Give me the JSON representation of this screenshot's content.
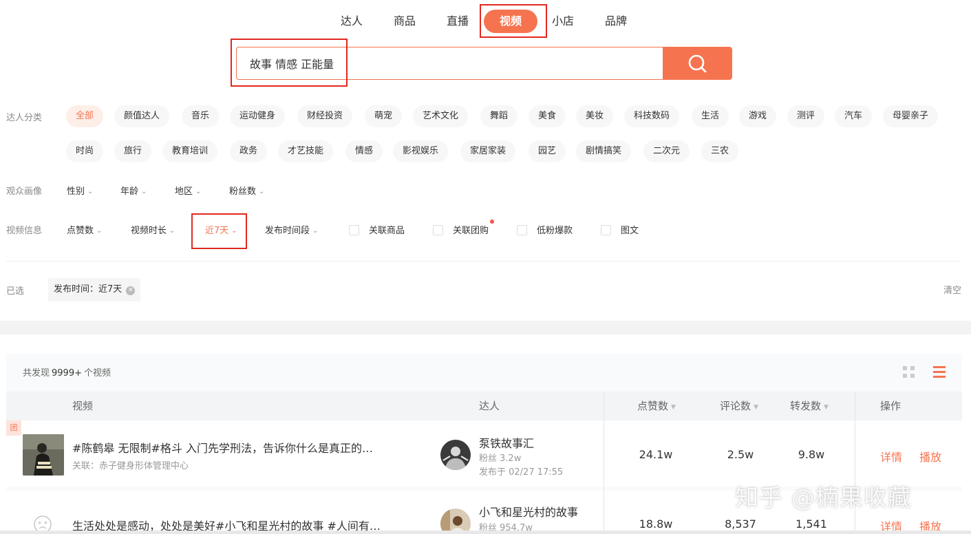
{
  "nav": {
    "items": [
      {
        "label": "达人"
      },
      {
        "label": "商品"
      },
      {
        "label": "直播"
      },
      {
        "label": "视频"
      },
      {
        "label": "小店"
      },
      {
        "label": "品牌"
      }
    ]
  },
  "search": {
    "value": "故事 情感 正能量"
  },
  "filters": {
    "category_label": "达人分类",
    "categories": [
      "全部",
      "颜值达人",
      "音乐",
      "运动健身",
      "财经投资",
      "萌宠",
      "艺术文化",
      "舞蹈",
      "美食",
      "美妆",
      "科技数码",
      "生活",
      "游戏",
      "测评",
      "汽车",
      "母婴亲子",
      "时尚",
      "旅行",
      "教育培训",
      "政务",
      "才艺技能",
      "情感",
      "影视娱乐",
      "家居家装",
      "园艺",
      "剧情搞笑",
      "二次元",
      "三农"
    ],
    "audience_label": "观众画像",
    "audience": [
      "性别",
      "年龄",
      "地区",
      "粉丝数"
    ],
    "video_label": "视频信息",
    "video_dropdowns": [
      "点赞数",
      "视频时长",
      "近7天",
      "发布时间段"
    ],
    "video_checkboxes": [
      "关联商品",
      "关联团购",
      "低粉爆款",
      "图文"
    ],
    "caret": "⌄"
  },
  "selected": {
    "label": "已选",
    "tag": "发布时间：近7天",
    "clear": "清空"
  },
  "results": {
    "prefix": "共发现",
    "count": "9999+",
    "suffix": "个视频",
    "headers": {
      "video": "视频",
      "creator": "达人",
      "likes": "点赞数",
      "comments": "评论数",
      "shares": "转发数",
      "actions": "操作"
    },
    "rows": [
      {
        "badge": "团",
        "title": "#陈鹤皋 无限制#格斗 入门先学刑法，告诉你什么是真正的…",
        "related": "关联：赤子健身形体管理中心",
        "creator": "泵铁故事汇",
        "fans_label": "粉丝",
        "fans": "3.2w",
        "published": "发布于 02/27 17:55",
        "likes": "24.1w",
        "comments": "2.5w",
        "shares": "9.8w",
        "detail": "详情",
        "play": "播放"
      },
      {
        "title": "生活处处是感动，处处是美好#小飞和星光村的故事 #人间有…",
        "creator": "小飞和星光村的故事",
        "fans_label": "粉丝",
        "fans": "954.7w",
        "likes": "18.8w",
        "comments": "8,537",
        "shares": "1,541",
        "detail": "详情",
        "play": "播放"
      }
    ]
  },
  "watermark": "知乎 @楠果收藏",
  "colors": {
    "accent": "#f5744f",
    "highlight_box": "#e0281e"
  }
}
